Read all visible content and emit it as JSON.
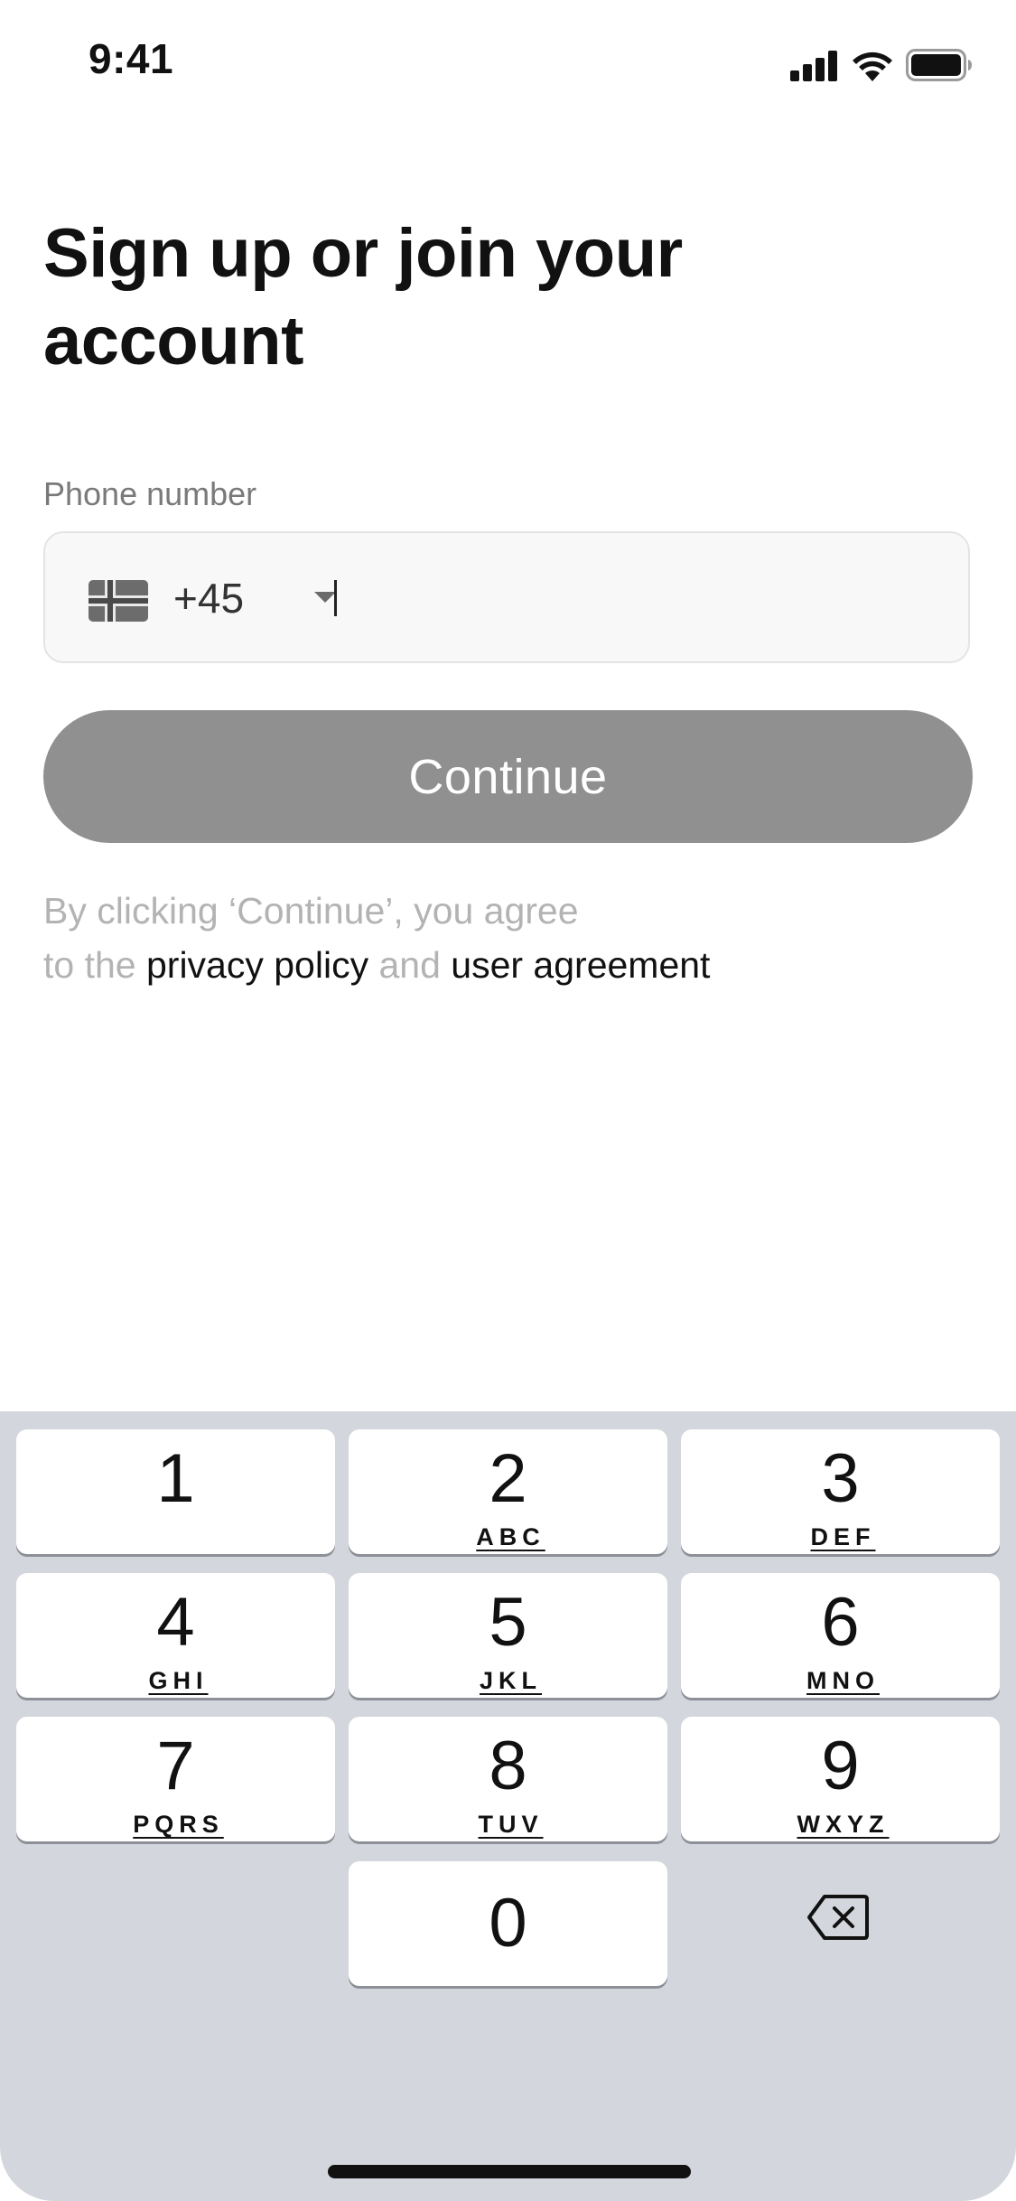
{
  "status_bar": {
    "time": "9:41",
    "icons": [
      "cellular-signal-icon",
      "wifi-icon",
      "battery-icon"
    ]
  },
  "title": "Sign up or join your account",
  "phone": {
    "label": "Phone number",
    "flag_icon": "norway-flag-icon",
    "dial_code": "+45",
    "value": ""
  },
  "continue_label": "Continue",
  "terms": {
    "line1": "By clicking ‘Continue’, you agree",
    "prefix": "to the ",
    "privacy_link": "privacy policy",
    "and": " and ",
    "agreement_link": "user agreement"
  },
  "keypad": {
    "keys": [
      {
        "digit": "1",
        "letters": ""
      },
      {
        "digit": "2",
        "letters": "ABC"
      },
      {
        "digit": "3",
        "letters": "DEF"
      },
      {
        "digit": "4",
        "letters": "GHI"
      },
      {
        "digit": "5",
        "letters": "JKL"
      },
      {
        "digit": "6",
        "letters": "MNO"
      },
      {
        "digit": "7",
        "letters": "PQRS"
      },
      {
        "digit": "8",
        "letters": "TUV"
      },
      {
        "digit": "9",
        "letters": "WXYZ"
      },
      {
        "digit": "0",
        "letters": ""
      }
    ],
    "delete_icon": "backspace-icon"
  },
  "colors": {
    "button_disabled": "#909090",
    "keypad_background": "#d3d6dc",
    "muted_text": "#b3b3b3"
  }
}
